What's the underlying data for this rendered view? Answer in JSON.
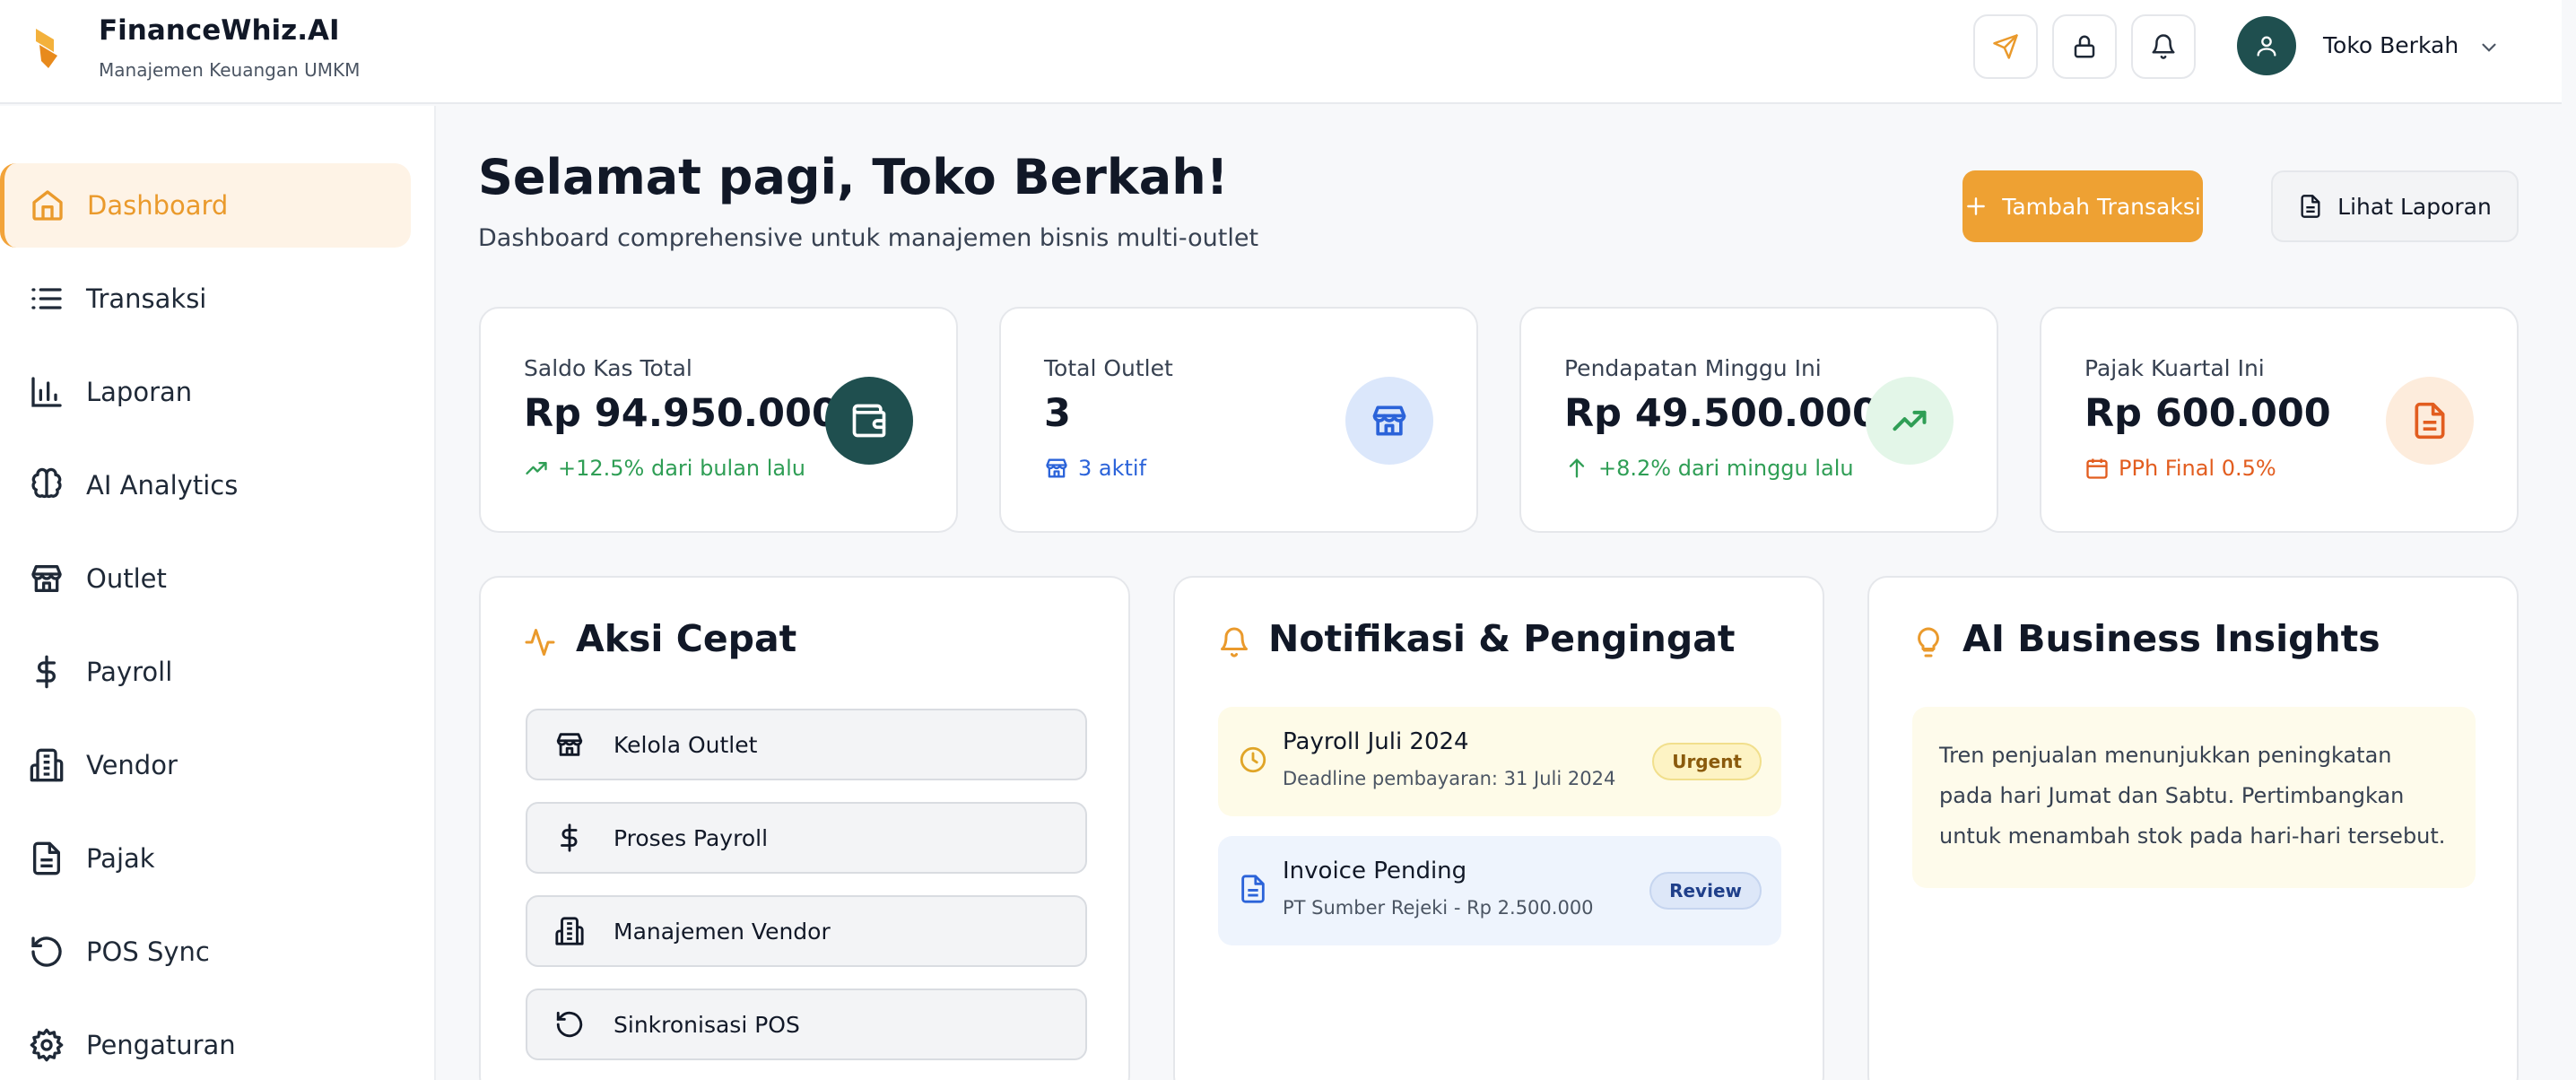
{
  "header": {
    "brand_name": "FinanceWhiz.AI",
    "brand_subtitle": "Manajemen Keuangan UMKM",
    "user_name": "Toko Berkah",
    "icons": [
      "send-icon",
      "lock-icon",
      "bell-icon",
      "user-icon",
      "chevron-down-icon"
    ]
  },
  "sidebar": {
    "items": [
      {
        "label": "Dashboard",
        "icon": "home-icon",
        "active": true
      },
      {
        "label": "Transaksi",
        "icon": "list-icon"
      },
      {
        "label": "Laporan",
        "icon": "bar-chart-icon"
      },
      {
        "label": "AI Analytics",
        "icon": "brain-icon"
      },
      {
        "label": "Outlet",
        "icon": "store-icon"
      },
      {
        "label": "Payroll",
        "icon": "dollar-icon"
      },
      {
        "label": "Vendor",
        "icon": "building-icon"
      },
      {
        "label": "Pajak",
        "icon": "file-icon"
      },
      {
        "label": "POS Sync",
        "icon": "rotate-icon"
      },
      {
        "label": "Pengaturan",
        "icon": "gear-icon"
      }
    ]
  },
  "main": {
    "greeting": "Selamat pagi, Toko Berkah!",
    "subtitle": "Dashboard comprehensive untuk manajemen bisnis multi-outlet",
    "add_transaction_label": "Tambah Transaksi",
    "view_report_label": "Lihat Laporan"
  },
  "stats": [
    {
      "title": "Saldo Kas Total",
      "value": "Rp 94.950.000",
      "sub": "+12.5% dari bulan lalu",
      "sub_color": "#2f9e55",
      "icon": "wallet-icon",
      "icon_bg": "#1f4f4f"
    },
    {
      "title": "Total Outlet",
      "value": "3",
      "sub": "3 aktif",
      "sub_color": "#2b63d9",
      "icon": "store-icon",
      "icon_bg": "#dbe7fb"
    },
    {
      "title": "Pendapatan Minggu Ini",
      "value": "Rp 49.500.000",
      "sub": "+8.2% dari minggu lalu",
      "sub_color": "#2f9e55",
      "icon": "trending-up-icon",
      "icon_bg": "#e3f6e8"
    },
    {
      "title": "Pajak Kuartal Ini",
      "value": "Rp 600.000",
      "sub": "PPh Final 0.5%",
      "sub_color": "#e25d1f",
      "icon": "file-text-icon",
      "icon_bg": "#fdecdc"
    }
  ],
  "quick_actions": {
    "title": "Aksi Cepat",
    "items": [
      {
        "label": "Kelola Outlet",
        "icon": "store-icon"
      },
      {
        "label": "Proses Payroll",
        "icon": "dollar-icon"
      },
      {
        "label": "Manajemen Vendor",
        "icon": "building-icon"
      },
      {
        "label": "Sinkronisasi POS",
        "icon": "rotate-icon"
      }
    ]
  },
  "notifications": {
    "title": "Notifikasi & Pengingat",
    "items": [
      {
        "title": "Payroll Juli 2024",
        "desc": "Deadline pembayaran: 31 Juli 2024",
        "badge": "Urgent",
        "icon": "clock-icon"
      },
      {
        "title": "Invoice Pending",
        "desc": "PT Sumber Rejeki - Rp 2.500.000",
        "badge": "Review",
        "icon": "file-text-icon"
      }
    ]
  },
  "insights": {
    "title": "AI Business Insights",
    "text": "Tren penjualan menunjukkan peningkatan pada hari Jumat dan Sabtu. Pertimbangkan untuk menambah stok pada hari-hari tersebut."
  },
  "colors": {
    "accent": "#eea133",
    "dark_teal": "#1f4f4f",
    "green": "#2f9e55",
    "blue": "#2b63d9",
    "orange": "#e25d1f"
  }
}
